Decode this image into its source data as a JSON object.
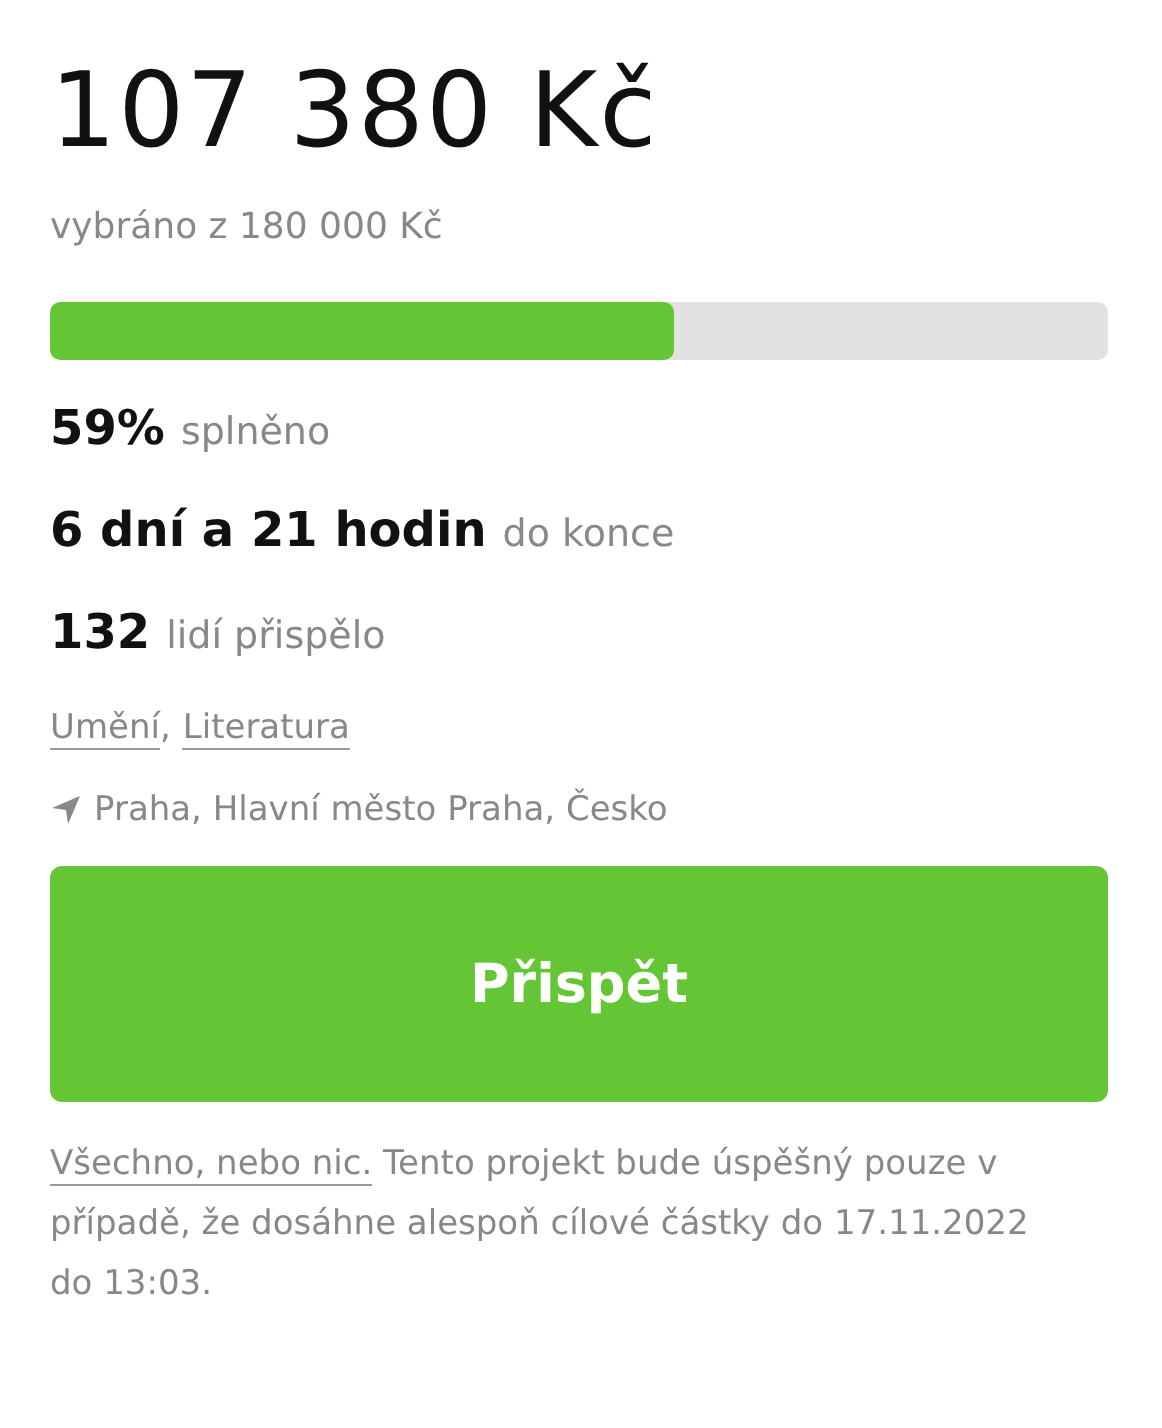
{
  "amount": "107 380 Kč",
  "goal": "vybráno z 180 000 Kč",
  "progress": {
    "level": 0.59
  },
  "stats": [
    {
      "value": "59%",
      "label": "splněno"
    },
    {
      "value": "6 dní a 21 hodin",
      "label": "do konce"
    },
    {
      "value": "132",
      "label": "lidí přispělo"
    }
  ],
  "categories": [
    "Umění",
    "Literatura"
  ],
  "category_separator": ",",
  "location": "Praha, Hlavní město Praha, Česko",
  "button": "Přispět",
  "note": {
    "link": "Všechno, nebo nic.",
    "text": "Tento projekt bude úspěšný pouze v případě, že dosáhne alespoň cílové částky do 17.11.2022 do 13:03."
  }
}
